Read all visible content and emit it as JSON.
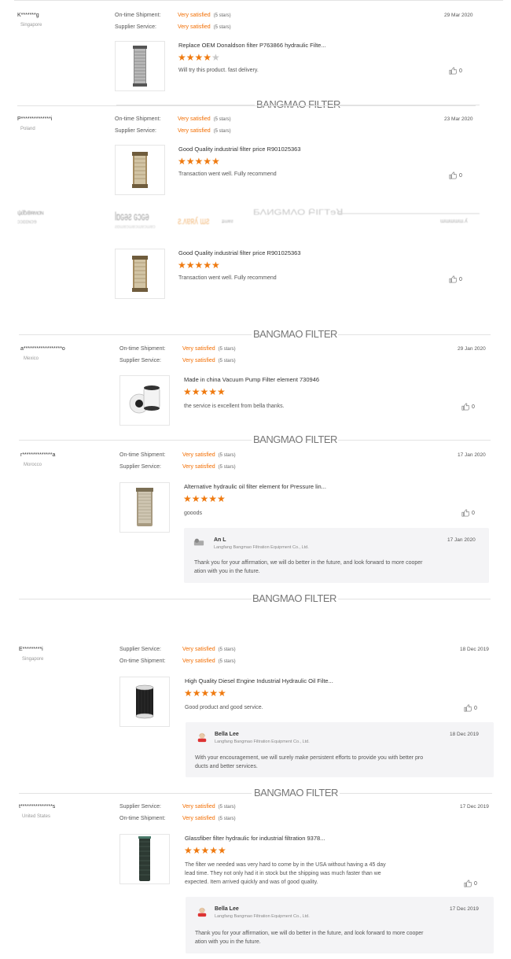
{
  "watermark": "BANGMAO FILTER",
  "labels": {
    "ontime": "On-time Shipment:",
    "supplier": "Supplier Service:"
  },
  "reviews": [
    {
      "user": "K*******g",
      "country": "Singapore",
      "date": "29 Mar 2020",
      "row1_label": "On-time Shipment:",
      "row1_value": "Very satisfied",
      "row1_note": "(5 stars)",
      "row2_label": "Supplier Service:",
      "row2_value": "Very satisfied",
      "row2_note": "(5 stars)",
      "product": "Replace OEM Donaldson filter P763866 hydraulic Filte...",
      "stars": 4,
      "comment": "Will try this product. fast delivery.",
      "likes": "0"
    },
    {
      "user": "P**************i",
      "country": "Poland",
      "date": "23 Mar 2020",
      "row1_label": "On-time Shipment:",
      "row1_value": "Very satisfied",
      "row1_note": "(5 stars)",
      "row2_label": "Supplier Service:",
      "row2_value": "Very satisfied",
      "row2_note": "(5 stars)",
      "product": "Good Quality industrial filter price R901025363",
      "stars": 5,
      "comment": "Transaction went well. Fully recommend",
      "likes": "0"
    },
    {
      "product": "Good Quality industrial filter price R901025363",
      "stars": 5,
      "comment": "Transaction went well. Fully recommend",
      "likes": "0"
    },
    {
      "user": "a******************o",
      "country": "Mexico",
      "date": "29 Jan 2020",
      "row1_label": "On-time Shipment:",
      "row1_value": "Very satisfied",
      "row1_note": "(5 stars)",
      "row2_label": "Supplier Service:",
      "row2_value": "Very satisfied",
      "row2_note": "(5 stars)",
      "product": "Made in china Vacuum Pump Filter element 730946",
      "stars": 5,
      "comment": "the service is excellent from bella thanks.",
      "likes": "0"
    },
    {
      "user": "r**************a",
      "country": "Morocco",
      "date": "17 Jan 2020",
      "row1_label": "On-time Shipment:",
      "row1_value": "Very satisfied",
      "row1_note": "(5 stars)",
      "row2_label": "Supplier Service:",
      "row2_value": "Very satisfied",
      "row2_note": "(5 stars)",
      "product": "Alternative hydraulic oil filter element for Pressure lin...",
      "stars": 5,
      "comment": "gooods",
      "likes": "0",
      "reply": {
        "name": "An L",
        "company": "Langfang Bangmao Filtration Equipment Co., Ltd.",
        "date": "17 Jan 2020",
        "text1": "Thank you for your affirmation, we will do better in the future, and look forward to more cooper",
        "text2": "ation with you in the future."
      }
    },
    {
      "user": "E*********i",
      "country": "Singapore",
      "date": "18 Dec 2019",
      "row1_label": "Supplier Service:",
      "row1_value": "Very satisfied",
      "row1_note": "(5 stars)",
      "row2_label": "On-time Shipment:",
      "row2_value": "Very satisfied",
      "row2_note": "(5 stars)",
      "product": "High Quality Diesel Engine Industrial Hydraulic Oil Filte...",
      "stars": 5,
      "comment": "Good product and good service.",
      "likes": "0",
      "reply": {
        "name": "Bella Lee",
        "company": "Langfang Bangmao Filtration Equipment Co., Ltd.",
        "date": "18 Dec 2019",
        "text1": "With your encouragement, we will surely make persistent efforts to provide you with better pro",
        "text2": "ducts and better services."
      }
    },
    {
      "user": "t***************s",
      "country": "United States",
      "date": "17 Dec 2019",
      "row1_label": "Supplier Service:",
      "row1_value": "Very satisfied",
      "row1_note": "(5 stars)",
      "row2_label": "On-time Shipment:",
      "row2_value": "Very satisfied",
      "row2_note": "(5 stars)",
      "product": "Glassfiber filter hydraulic for industrial filtration 9378...",
      "stars": 5,
      "comment1": "The filter we needed was very hard to come by in the USA without having a 45 day",
      "comment2": "lead time. They not only had it in stock but the shipping was much faster than we",
      "comment3": "expected. Item arrived quickly and was of good quality.",
      "likes": "0",
      "reply": {
        "name": "Bella Lee",
        "company": "Langfang Bangmao Filtration Equipment Co., Ltd.",
        "date": "17 Dec 2019",
        "text1": "Thank you for your affirmation, we will do better in the future, and look forward to more cooper",
        "text2": "ation with you in the future."
      }
    }
  ],
  "colors": {
    "accent": "#f26d00",
    "star": "#ef7a10",
    "star_off": "#c8c8c8"
  },
  "icons": {
    "like": "thumbs-up-icon",
    "avatar": "avatar-icon"
  }
}
